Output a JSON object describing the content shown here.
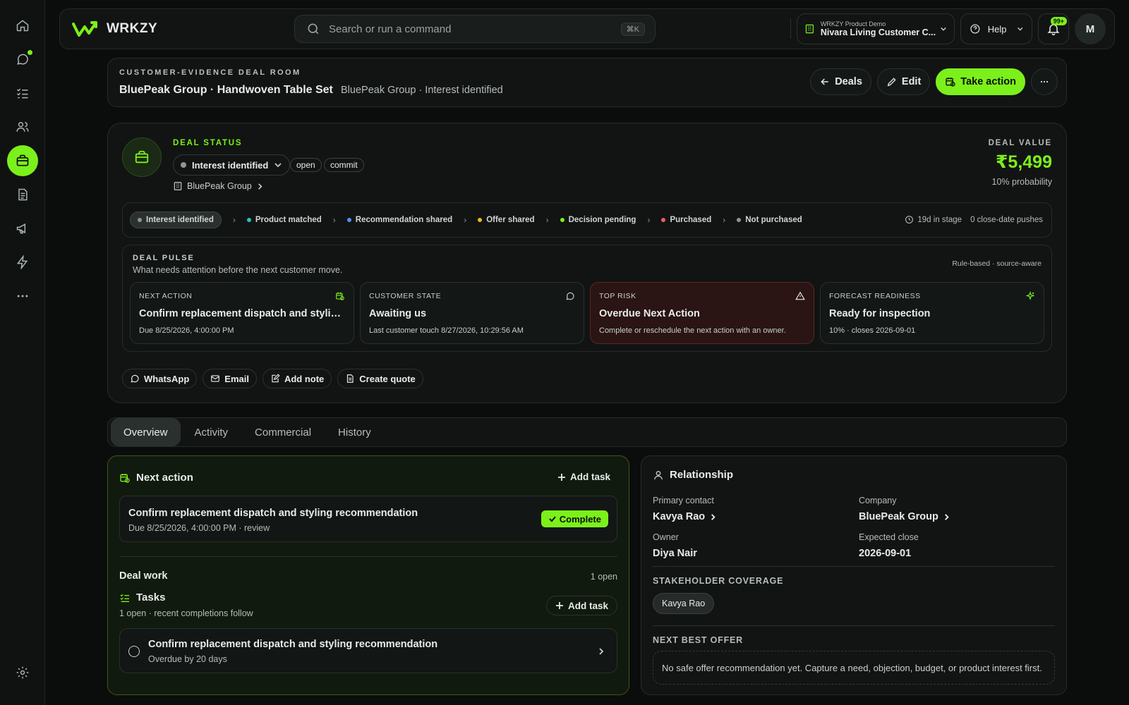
{
  "sidebar": {
    "items": [
      {
        "icon": "home-icon"
      },
      {
        "icon": "chat-icon",
        "dot": true
      },
      {
        "icon": "checklist-icon"
      },
      {
        "icon": "users-icon"
      },
      {
        "icon": "briefcase-icon",
        "active": true
      },
      {
        "icon": "document-icon"
      },
      {
        "icon": "megaphone-icon"
      },
      {
        "icon": "lightning-icon"
      },
      {
        "icon": "more-icon"
      }
    ],
    "settings_icon": "gear-icon"
  },
  "topbar": {
    "brand": "WRKZY",
    "search_placeholder": "Search or run a command",
    "search_shortcut": "⌘K",
    "workspace_sub": "WRKZY Product Demo",
    "workspace_name": "Nivara Living Customer C...",
    "help_label": "Help",
    "notifications_badge": "99+",
    "avatar_initial": "M"
  },
  "header": {
    "eyebrow": "CUSTOMER-EVIDENCE DEAL ROOM",
    "title": "BluePeak Group · Handwoven Table Set",
    "subtitle": "BluePeak Group · Interest identified",
    "deals_label": "Deals",
    "edit_label": "Edit",
    "take_action_label": "Take action"
  },
  "status": {
    "label": "DEAL STATUS",
    "stage": "Interest identified",
    "pills": [
      "open",
      "commit"
    ],
    "company": "BluePeak Group",
    "deal_value_label": "DEAL VALUE",
    "deal_value": "₹5,499",
    "probability": "10% probability"
  },
  "pipeline": {
    "stages": [
      {
        "label": "Interest identified",
        "color": "#8e9692",
        "active": true
      },
      {
        "label": "Product matched",
        "color": "#22c5c5"
      },
      {
        "label": "Recommendation shared",
        "color": "#5b8cf5"
      },
      {
        "label": "Offer shared",
        "color": "#f5b520"
      },
      {
        "label": "Decision pending",
        "color": "#7cf01a"
      },
      {
        "label": "Purchased",
        "color": "#f05a6e"
      },
      {
        "label": "Not purchased",
        "color": "#8e9692"
      }
    ],
    "days_in_stage": "19d in stage",
    "pushes": "0 close-date pushes"
  },
  "pulse": {
    "label": "DEAL PULSE",
    "subtitle": "What needs attention before the next customer move.",
    "note": "Rule-based · source-aware",
    "cards": [
      {
        "label": "NEXT ACTION",
        "title": "Confirm replacement dispatch and styling recommendation",
        "sub": "Due 8/25/2026, 4:00:00 PM",
        "icon": "calendar-clock-icon"
      },
      {
        "label": "CUSTOMER STATE",
        "title": "Awaiting us",
        "sub": "Last customer touch 8/27/2026, 10:29:56 AM",
        "icon": "chat-bubble-icon"
      },
      {
        "label": "TOP RISK",
        "title": "Overdue Next Action",
        "sub": "Complete or reschedule the next action with an owner.",
        "icon": "warning-icon"
      },
      {
        "label": "FORECAST READINESS",
        "title": "Ready for inspection",
        "sub": "10% · closes 2026-09-01",
        "icon": "sparkle-icon"
      }
    ]
  },
  "quick_actions": [
    "WhatsApp",
    "Email",
    "Add note",
    "Create quote"
  ],
  "tabs": [
    "Overview",
    "Activity",
    "Commercial",
    "History"
  ],
  "next_action": {
    "title": "Next action",
    "add_task": "Add task",
    "item_title": "Confirm replacement dispatch and styling recommendation",
    "item_sub": "Due 8/25/2026, 4:00:00 PM · review",
    "complete_label": "Complete",
    "deal_work": "Deal work",
    "deal_work_count": "1 open",
    "tasks_title": "Tasks",
    "tasks_sub": "1 open · recent completions follow",
    "add_task_2": "Add task",
    "task_title": "Confirm replacement dispatch and styling recommendation",
    "task_sub": "Overdue by 20 days"
  },
  "relationship": {
    "title": "Relationship",
    "primary_contact_label": "Primary contact",
    "primary_contact": "Kavya Rao",
    "company_label": "Company",
    "company": "BluePeak Group",
    "owner_label": "Owner",
    "owner": "Diya Nair",
    "expected_close_label": "Expected close",
    "expected_close": "2026-09-01",
    "stakeholder_label": "STAKEHOLDER COVERAGE",
    "stakeholder_chip": "Kavya Rao",
    "nbo_label": "NEXT BEST OFFER",
    "nbo_text": "No safe offer recommendation yet. Capture a need, objection, budget, or product interest first."
  },
  "colors": {
    "accent": "#7cf01a",
    "background": "#0b0d0c",
    "risk": "#2a1414"
  }
}
